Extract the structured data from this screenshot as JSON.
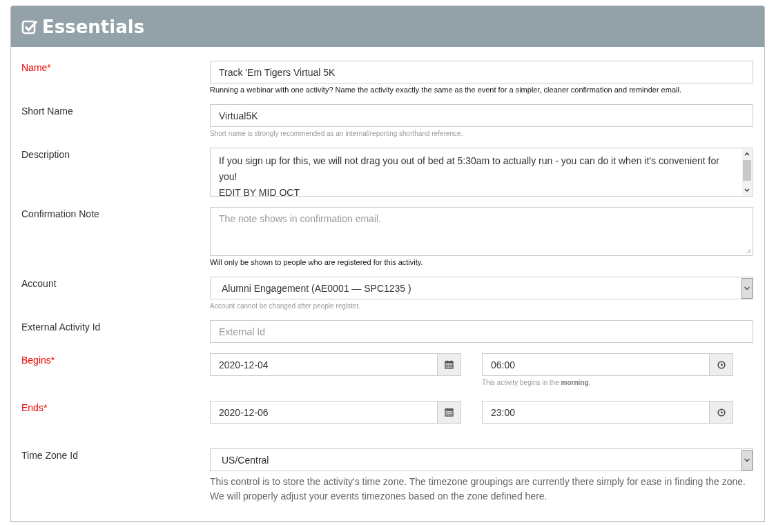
{
  "panel": {
    "title": "Essentials"
  },
  "fields": [
    {
      "kind": "text",
      "label": "Name*",
      "required": true,
      "value": "Track 'Em Tigers Virtual 5K",
      "help": {
        "kind": "note",
        "text": "Running a webinar with one activity? Name the activity exactly the same as the event for a simpler, cleaner confirmation and reminder email."
      }
    },
    {
      "kind": "text",
      "label": "Short Name",
      "required": false,
      "value": "Virtual5K",
      "help": {
        "kind": "hint",
        "text": "Short name is strongly recommended as an internal/reporting shorthand reference."
      }
    },
    {
      "kind": "textarea",
      "label": "Description",
      "required": false,
      "value": "If you sign up for this, we will not drag you out of bed at 5:30am to actually run - you can do it when it's convenient for you!\nEDIT BY MID OCT",
      "scrollbar": true
    },
    {
      "kind": "textarea",
      "label": "Confirmation Note",
      "required": false,
      "placeholder": "The note shows in confirmation email.",
      "help": {
        "kind": "note",
        "text": "Will only be shown to people who are registered for this activity."
      }
    },
    {
      "kind": "select",
      "label": "Account",
      "required": false,
      "value": "Alumni Engagement (AE0001 — SPC1235 )",
      "help": {
        "kind": "hint",
        "text": "Account cannot be changed after people register."
      }
    },
    {
      "kind": "text",
      "label": "External Activity Id",
      "required": false,
      "placeholder": "External Id"
    },
    {
      "kind": "datetime",
      "label": "Begins*",
      "required": true,
      "date": "2020-12-04",
      "time": "06:00",
      "help": {
        "kind": "hint",
        "text": "This activity begins in the **morning**."
      }
    },
    {
      "kind": "datetime",
      "label": "Ends*",
      "required": true,
      "date": "2020-12-06",
      "time": "23:00"
    },
    {
      "kind": "select",
      "label": "Time Zone Id",
      "required": false,
      "value": "US/Central",
      "help": {
        "kind": "explanation",
        "text": "This control is to store the activity's time zone. The timezone groupings are currently there simply for ease in finding the zone. We will properly adjust your events timezones based on the zone defined here."
      }
    }
  ]
}
